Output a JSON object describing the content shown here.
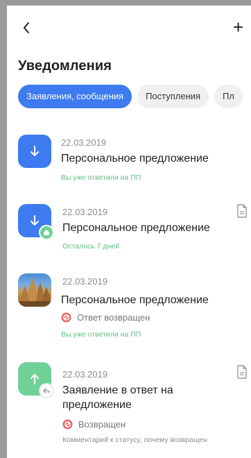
{
  "header": {
    "title": "Уведомления",
    "add_label": "+"
  },
  "tabs": [
    {
      "label": "Заявления, сообщения",
      "active": true
    },
    {
      "label": "Поступления",
      "active": false
    },
    {
      "label": "Пл",
      "active": false
    }
  ],
  "notifications": [
    {
      "date": "22.03.2019",
      "title": "Персональное предложение",
      "note": "Вы уже ответили на ПП"
    },
    {
      "date": "22.03.2019",
      "title": "Персональное предложение",
      "note": "Осталось 7 дней"
    },
    {
      "date": "22.03.2019",
      "title": "Персональное предложение",
      "status": "Ответ возвращен",
      "note": "Вы уже ответили на ПП"
    },
    {
      "date": "22.03.2019",
      "title_line1": "Заявление в ответ на",
      "title_line2": "предложение",
      "status": "Возвращен",
      "comment": "Комментарий к статусу, почему возвращен"
    }
  ],
  "colors": {
    "accent": "#3e7bf0",
    "green": "#6fd196",
    "note_green": "#5fbf86",
    "error": "#e46a6a"
  },
  "icons": {
    "back": "chevron-left-icon",
    "add": "plus-icon",
    "incoming": "arrow-down-icon",
    "outgoing": "arrow-up-icon",
    "document": "document-icon",
    "returned": "cancel-circle-icon"
  }
}
